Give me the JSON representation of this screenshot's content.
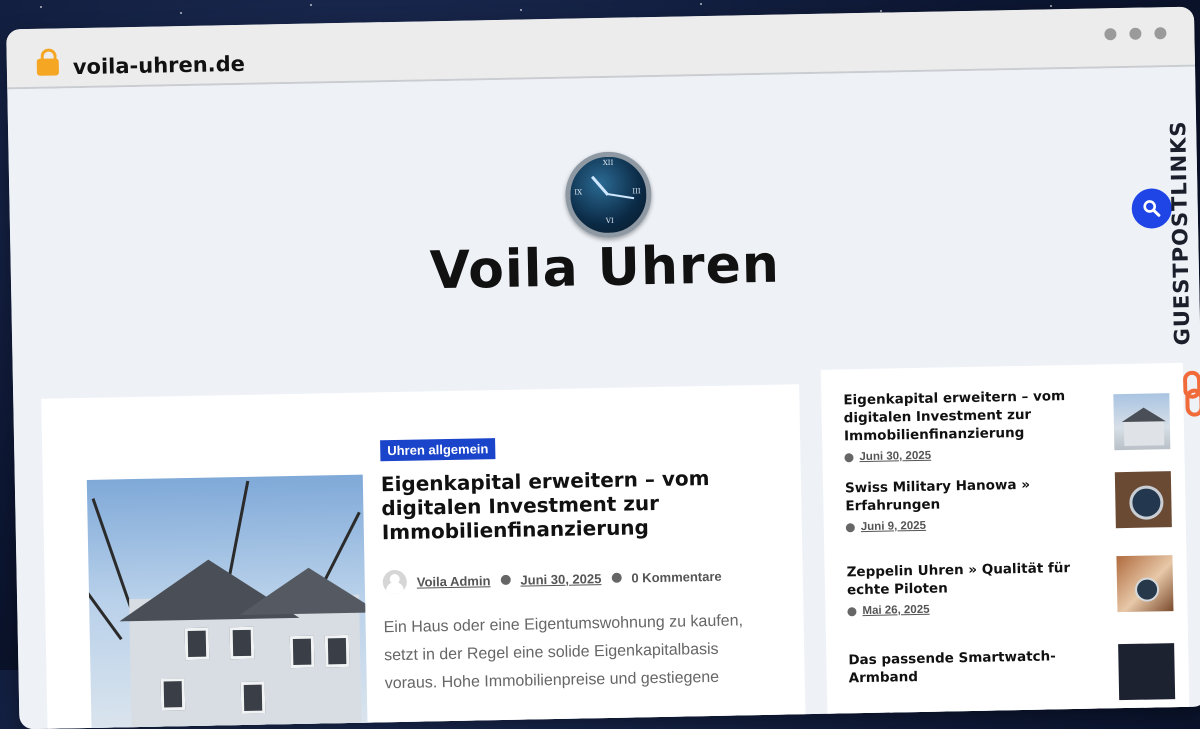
{
  "browser": {
    "url": "voila-uhren.de"
  },
  "site": {
    "title": "Voila Uhren"
  },
  "watermark": {
    "text": "GUESTPOSTLINKS"
  },
  "main_post": {
    "category": "Uhren allgemein",
    "title": "Eigenkapital erweitern – vom digitalen Investment zur Immobilienfinanzierung",
    "author": "Voila Admin",
    "date": "Juni 30, 2025",
    "comments": "0 Kommentare",
    "excerpt": "Ein Haus oder eine Eigentumswohnung zu kaufen, setzt in der Regel eine solide Eigenkapitalbasis voraus. Hohe Immobilienpreise und gestiegene"
  },
  "sidebar": {
    "items": [
      {
        "title": "Eigenkapital erweitern – vom digitalen Investment zur Immobilienfinanzierung",
        "date": "Juni 30, 2025"
      },
      {
        "title": "Swiss Military Hanowa » Erfahrungen",
        "date": "Juni 9, 2025"
      },
      {
        "title": "Zeppelin Uhren » Qualität für echte Piloten",
        "date": "Mai 26, 2025"
      },
      {
        "title": "Das passende Smartwatch-Armband",
        "date": ""
      }
    ]
  },
  "icons": {
    "lock": "lock-icon",
    "search": "search-icon",
    "calendar": "clock-icon",
    "comments": "comments-icon",
    "logo": "clock-logo-icon"
  },
  "colors": {
    "accent": "#1f45e6",
    "badge": "#1a44c9",
    "lock": "#f5a623",
    "watermark_icon": "#f06a3a"
  }
}
